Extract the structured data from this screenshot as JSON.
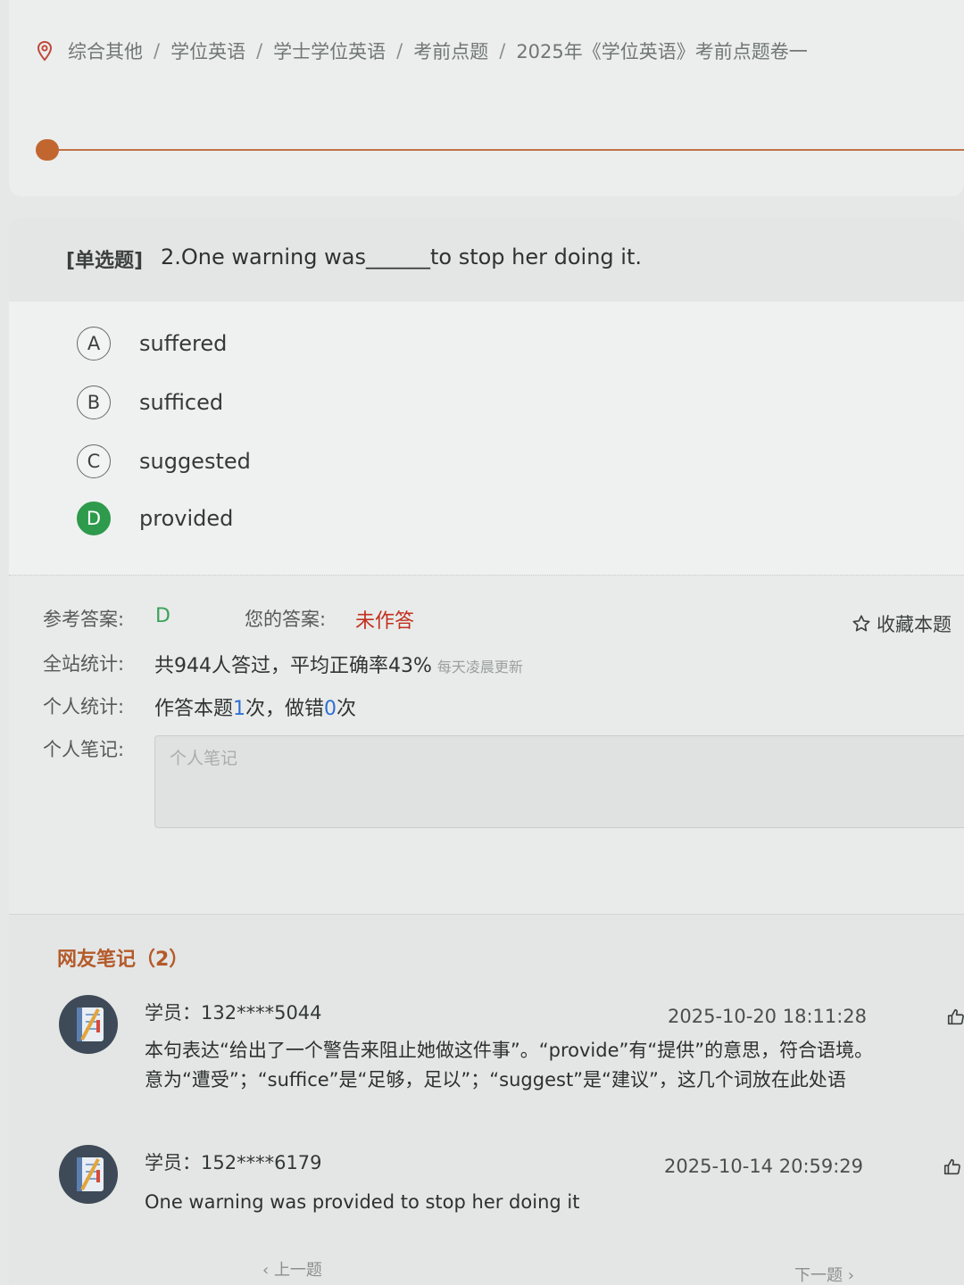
{
  "breadcrumb": {
    "icon": "location-pin-icon",
    "items": [
      "综合其他",
      "学位英语",
      "学士学位英语",
      "考前点题",
      "2025年《学位英语》考前点题卷一"
    ],
    "separator": "/"
  },
  "progress": {
    "fraction": 0.01
  },
  "question": {
    "type_label": "[单选题]",
    "text": "2.One warning was______to stop her doing it.",
    "options": [
      {
        "letter": "A",
        "text": "suffered",
        "correct": false
      },
      {
        "letter": "B",
        "text": "sufficed",
        "correct": false
      },
      {
        "letter": "C",
        "text": "suggested",
        "correct": false
      },
      {
        "letter": "D",
        "text": "provided",
        "correct": true
      }
    ]
  },
  "answer": {
    "reference_label": "参考答案:",
    "reference_value": "D",
    "yours_label": "您的答案:",
    "yours_value": "未作答",
    "favorite_label": "收藏本题",
    "site_stats_label": "全站统计:",
    "site_stats_value": "共944人答过，平均正确率43%",
    "site_stats_note": "每天凌晨更新",
    "personal_stats_label": "个人统计:",
    "personal_stats_pre": "作答本题",
    "personal_attempts": "1",
    "personal_stats_mid": "次，做错",
    "personal_wrong": "0",
    "personal_stats_post": "次",
    "note_label": "个人笔记:",
    "note_placeholder": "个人笔记"
  },
  "notes": {
    "title": "网友笔记（2）",
    "items": [
      {
        "user": "学员：132****5044",
        "time": "2025-10-20 18:11:28",
        "lines": [
          "本句表达“给出了一个警告来阻止她做这件事”。“provide”有“提供”的意思，符合语境。",
          "意为“遭受”；“suffice”是“足够，足以”；“suggest”是“建议”，这几个词放在此处语"
        ]
      },
      {
        "user": "学员：152****6179",
        "time": "2025-10-14 20:59:29",
        "lines": [
          "One warning was provided to stop her doing it"
        ]
      }
    ]
  },
  "nav": {
    "prev": "上一题",
    "next": "下一题"
  }
}
